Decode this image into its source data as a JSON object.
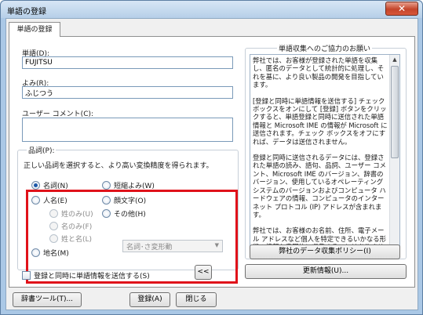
{
  "window": {
    "title": "単語の登録",
    "close_glyph": "✕"
  },
  "tab": {
    "label": "単語の登録"
  },
  "word": {
    "label": "単語(D):",
    "value": "FUJITSU"
  },
  "reading": {
    "label": "よみ(R):",
    "value": "ふじつう"
  },
  "comment": {
    "label": "ユーザー コメント(C):"
  },
  "pos": {
    "legend": "品詞(P):",
    "hint": "正しい品詞を選択すると、より高い変換精度を得られます。",
    "options": {
      "noun": "名詞(N)",
      "person": "人名(E)",
      "surname_only": "姓のみ(U)",
      "given_only": "名のみ(F)",
      "surname_given": "姓と名(L)",
      "place": "地名(M)",
      "short_reading": "短縮よみ(W)",
      "emoticon": "顔文字(O)",
      "other": "その他(H)"
    },
    "other_select_value": "名詞･さ変形動"
  },
  "send_checkbox": {
    "label": "登録と同時に単語情報を送信する(S)"
  },
  "collapse_button": {
    "label": "<<"
  },
  "info": {
    "legend": "単語収集へのご協力のお願い",
    "paragraphs": [
      "弊社では、お客様が登録された単語を収集し、匿名のデータとして統計的に処理し、それを基に、より良い製品の開発を目指しています。",
      "[登録と同時に単語情報を送信する] チェック ボックスをオンにして [登録] ボタンをクリックすると、単語登録と同時に送信された単語情報と Microsoft IME の情報が Microsoft に送信されます。チェック ボックスをオフにすれば、データは送信されません。",
      "登録と同時に送信されるデータには、登録された単語の読み、語句、品詞、ユーザー コメント、Microsoft IME のバージョン、辞書のバージョン、使用しているオペレーティング システムのバージョンおよびコンピュータ ハードウェアの情報、コンピュータのインターネット プロトコル (IP) アドレスが含まれます。",
      "弊社では、お客様のお名前、住所、電子メール アドレスなど個人を特定できるいかなる形態の情報も意図的に収集することはありません。"
    ],
    "policy_button": "弊社のデータ収集ポリシー(I)"
  },
  "buttons": {
    "update": "更新情報(U)...",
    "dictionary_tool": "辞書ツール(T)...",
    "register": "登録(A)",
    "close": "閉じる"
  }
}
